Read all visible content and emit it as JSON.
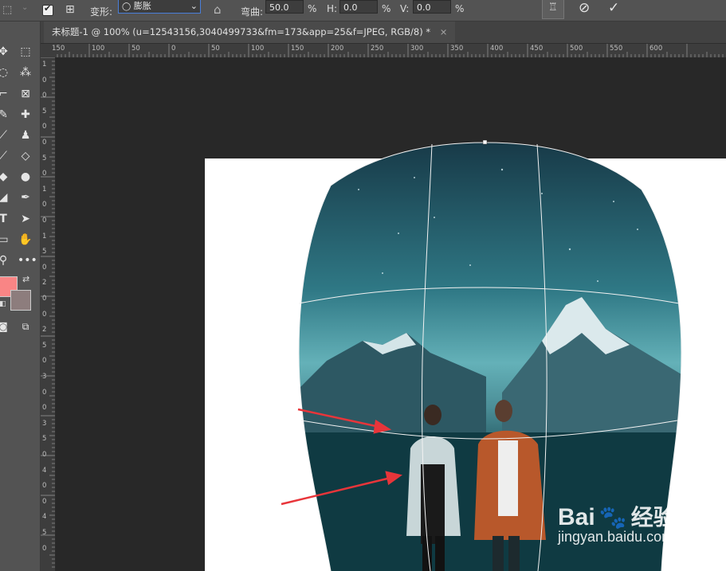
{
  "options_bar": {
    "transform_label": "变形:",
    "warp_value": "膨胀",
    "bend_label": "弯曲:",
    "bend_value": "50.0",
    "h_label": "H:",
    "h_value": "0.0",
    "v_label": "V:",
    "v_value": "0.0",
    "percent": "%",
    "cancel_icon": "cancel-icon",
    "commit_icon": "check-icon"
  },
  "document": {
    "tab_title": "未标题-1 @ 100% (u=12543156,3040499733&fm=173&app=25&f=JPEG, RGB/8) *",
    "tab_close": "×"
  },
  "ruler": {
    "h_labels": [
      "150",
      "100",
      "50",
      "0",
      "50",
      "100",
      "150",
      "200",
      "250",
      "300",
      "350",
      "400",
      "450",
      "500",
      "550",
      "600"
    ],
    "v_labels": [
      "1",
      "0",
      "0",
      "5",
      "0",
      "0",
      "5",
      "0",
      "1",
      "0",
      "0",
      "1",
      "5",
      "0",
      "2",
      "0",
      "0",
      "2",
      "5",
      "0",
      "3",
      "0",
      "0",
      "3",
      "5",
      "0",
      "4",
      "0",
      "0",
      "4",
      "5",
      "0"
    ]
  },
  "colors": {
    "foreground": "#f98585",
    "background": "#8d7d7d",
    "ui_bg": "#535353",
    "pasteboard": "#282828"
  },
  "watermark": {
    "brand_text": "Bai",
    "brand_suffix": "经验",
    "url": "jingyan.baidu.com"
  }
}
